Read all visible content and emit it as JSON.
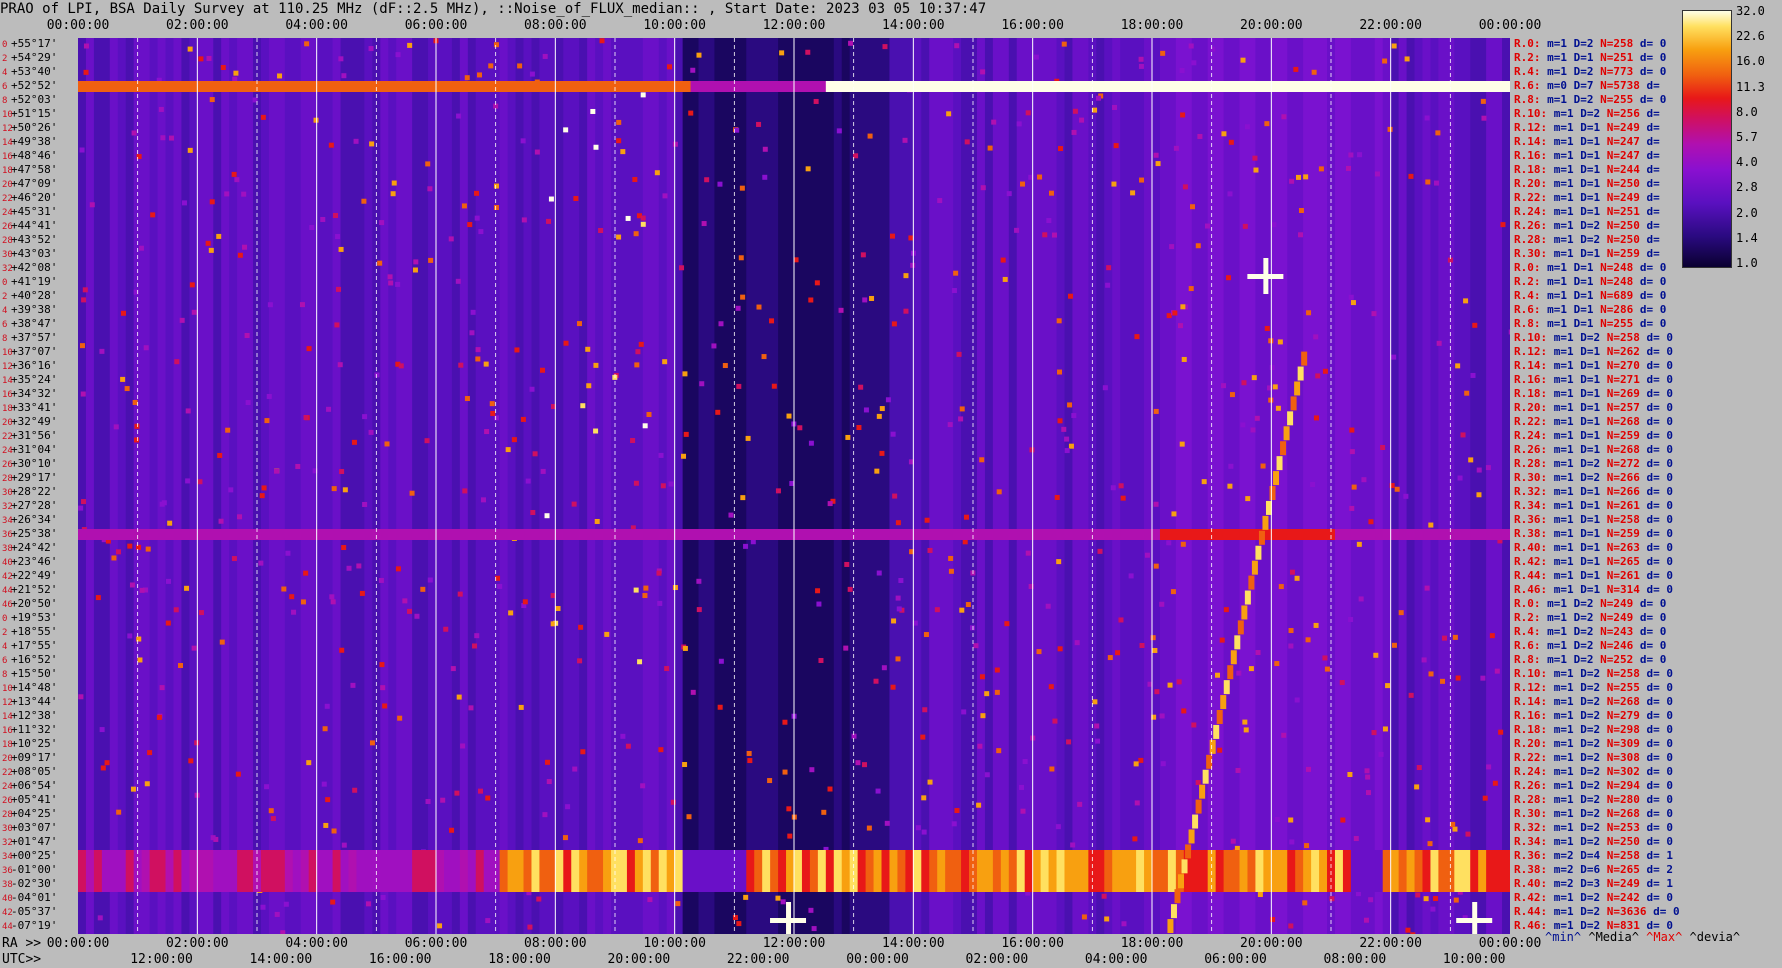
{
  "title": "PRAO of LPI, BSA Daily Survey at 110.25 MHz (dF::2.5 MHz), ::Noise_of_FLUX_median:: , Start Date: 2023 03 05 10:37:47",
  "chart_data": {
    "type": "heatmap",
    "title": "PRAO of LPI, BSA Daily Survey at 110.25 MHz (dF::2.5 MHz), ::Noise_of_FLUX_median:: , Start Date: 2023 03 05 10:37:47",
    "top_time_ticks": [
      "00:00:00",
      "02:00:00",
      "04:00:00",
      "06:00:00",
      "08:00:00",
      "10:00:00",
      "12:00:00",
      "14:00:00",
      "16:00:00",
      "18:00:00",
      "20:00:00",
      "22:00:00",
      "00:00:00"
    ],
    "ra_ticks": [
      "00:00:00",
      "02:00:00",
      "04:00:00",
      "06:00:00",
      "08:00:00",
      "10:00:00",
      "12:00:00",
      "14:00:00",
      "16:00:00",
      "18:00:00",
      "20:00:00",
      "22:00:00",
      "00:00:00"
    ],
    "utc_ticks": [
      "12:00:00",
      "14:00:00",
      "16:00:00",
      "18:00:00",
      "20:00:00",
      "22:00:00",
      "00:00:00",
      "02:00:00",
      "04:00:00",
      "06:00:00",
      "08:00:00",
      "10:00:00"
    ],
    "ra_prefix": "RA >>",
    "utc_prefix": "UTC>>",
    "colorbar_ticks": [
      "32.0",
      "22.6",
      "16.0",
      "11.3",
      "8.0",
      "5.7",
      "4.0",
      "2.8",
      "2.0",
      "1.4",
      "1.0"
    ],
    "legend": [
      "^min^",
      "^Media^",
      "^Max^",
      "^devia^"
    ],
    "declinations": [
      {
        "i": "0",
        "d": "+55°17'"
      },
      {
        "i": "2",
        "d": "+54°29'"
      },
      {
        "i": "4",
        "d": "+53°40'"
      },
      {
        "i": "6",
        "d": "+52°52'"
      },
      {
        "i": "8",
        "d": "+52°03'"
      },
      {
        "i": "10",
        "d": "+51°15'"
      },
      {
        "i": "12",
        "d": "+50°26'"
      },
      {
        "i": "14",
        "d": "+49°38'"
      },
      {
        "i": "16",
        "d": "+48°46'"
      },
      {
        "i": "18",
        "d": "+47°58'"
      },
      {
        "i": "20",
        "d": "+47°09'"
      },
      {
        "i": "22",
        "d": "+46°20'"
      },
      {
        "i": "24",
        "d": "+45°31'"
      },
      {
        "i": "26",
        "d": "+44°41'"
      },
      {
        "i": "28",
        "d": "+43°52'"
      },
      {
        "i": "30",
        "d": "+43°03'"
      },
      {
        "i": "32",
        "d": "+42°08'"
      },
      {
        "i": "0",
        "d": "+41°19'"
      },
      {
        "i": "2",
        "d": "+40°28'"
      },
      {
        "i": "4",
        "d": "+39°38'"
      },
      {
        "i": "6",
        "d": "+38°47'"
      },
      {
        "i": "8",
        "d": "+37°57'"
      },
      {
        "i": "10",
        "d": "+37°07'"
      },
      {
        "i": "12",
        "d": "+36°16'"
      },
      {
        "i": "14",
        "d": "+35°24'"
      },
      {
        "i": "16",
        "d": "+34°32'"
      },
      {
        "i": "18",
        "d": "+33°41'"
      },
      {
        "i": "20",
        "d": "+32°49'"
      },
      {
        "i": "22",
        "d": "+31°56'"
      },
      {
        "i": "24",
        "d": "+31°04'"
      },
      {
        "i": "26",
        "d": "+30°10'"
      },
      {
        "i": "28",
        "d": "+29°17'"
      },
      {
        "i": "30",
        "d": "+28°22'"
      },
      {
        "i": "32",
        "d": "+27°28'"
      },
      {
        "i": "34",
        "d": "+26°34'"
      },
      {
        "i": "36",
        "d": "+25°38'"
      },
      {
        "i": "38",
        "d": "+24°42'"
      },
      {
        "i": "40",
        "d": "+23°46'"
      },
      {
        "i": "42",
        "d": "+22°49'"
      },
      {
        "i": "44",
        "d": "+21°52'"
      },
      {
        "i": "46",
        "d": "+20°50'"
      },
      {
        "i": "0",
        "d": "+19°53'"
      },
      {
        "i": "2",
        "d": "+18°55'"
      },
      {
        "i": "4",
        "d": "+17°55'"
      },
      {
        "i": "6",
        "d": "+16°52'"
      },
      {
        "i": "8",
        "d": "+15°50'"
      },
      {
        "i": "10",
        "d": "+14°48'"
      },
      {
        "i": "12",
        "d": "+13°44'"
      },
      {
        "i": "14",
        "d": "+12°38'"
      },
      {
        "i": "16",
        "d": "+11°32'"
      },
      {
        "i": "18",
        "d": "+10°25'"
      },
      {
        "i": "20",
        "d": "+09°17'"
      },
      {
        "i": "22",
        "d": "+08°05'"
      },
      {
        "i": "24",
        "d": "+06°54'"
      },
      {
        "i": "26",
        "d": "+05°41'"
      },
      {
        "i": "28",
        "d": "+04°25'"
      },
      {
        "i": "30",
        "d": "+03°07'"
      },
      {
        "i": "32",
        "d": "+01°47'"
      },
      {
        "i": "34",
        "d": "+00°25'"
      },
      {
        "i": "36",
        "d": "-01°00'"
      },
      {
        "i": "38",
        "d": "-02°30'"
      },
      {
        "i": "40",
        "d": "-04°01'"
      },
      {
        "i": "42",
        "d": "-05°37'"
      },
      {
        "i": "44",
        "d": "-07°19'"
      }
    ],
    "row_stats": [
      {
        "r": "R.0:",
        "m": "m=1",
        "d": "D=2",
        "n": "N=258",
        "v": "d= 0"
      },
      {
        "r": "R.2:",
        "m": "m=1",
        "d": "D=1",
        "n": "N=251",
        "v": "d= 0"
      },
      {
        "r": "R.4:",
        "m": "m=1",
        "d": "D=2",
        "n": "N=773",
        "v": "d= 0"
      },
      {
        "r": "R.6:",
        "m": "m=0",
        "d": "D=7",
        "n": "N=5738",
        "v": "d="
      },
      {
        "r": "R.8:",
        "m": "m=1",
        "d": "D=2",
        "n": "N=255",
        "v": "d= 0"
      },
      {
        "r": "R.10:",
        "m": "m=1",
        "d": "D=2",
        "n": "N=256",
        "v": "d="
      },
      {
        "r": "R.12:",
        "m": "m=1",
        "d": "D=1",
        "n": "N=249",
        "v": "d="
      },
      {
        "r": "R.14:",
        "m": "m=1",
        "d": "D=1",
        "n": "N=247",
        "v": "d="
      },
      {
        "r": "R.16:",
        "m": "m=1",
        "d": "D=1",
        "n": "N=247",
        "v": "d="
      },
      {
        "r": "R.18:",
        "m": "m=1",
        "d": "D=1",
        "n": "N=244",
        "v": "d="
      },
      {
        "r": "R.20:",
        "m": "m=1",
        "d": "D=1",
        "n": "N=250",
        "v": "d="
      },
      {
        "r": "R.22:",
        "m": "m=1",
        "d": "D=1",
        "n": "N=249",
        "v": "d="
      },
      {
        "r": "R.24:",
        "m": "m=1",
        "d": "D=1",
        "n": "N=251",
        "v": "d="
      },
      {
        "r": "R.26:",
        "m": "m=1",
        "d": "D=2",
        "n": "N=250",
        "v": "d="
      },
      {
        "r": "R.28:",
        "m": "m=1",
        "d": "D=2",
        "n": "N=250",
        "v": "d="
      },
      {
        "r": "R.30:",
        "m": "m=1",
        "d": "D=1",
        "n": "N=259",
        "v": "d="
      },
      {
        "r": "R.0:",
        "m": "m=1",
        "d": "D=1",
        "n": "N=248",
        "v": "d= 0"
      },
      {
        "r": "R.2:",
        "m": "m=1",
        "d": "D=1",
        "n": "N=248",
        "v": "d= 0"
      },
      {
        "r": "R.4:",
        "m": "m=1",
        "d": "D=1",
        "n": "N=689",
        "v": "d= 0"
      },
      {
        "r": "R.6:",
        "m": "m=1",
        "d": "D=1",
        "n": "N=286",
        "v": "d= 0"
      },
      {
        "r": "R.8:",
        "m": "m=1",
        "d": "D=1",
        "n": "N=255",
        "v": "d= 0"
      },
      {
        "r": "R.10:",
        "m": "m=1",
        "d": "D=2",
        "n": "N=258",
        "v": "d= 0"
      },
      {
        "r": "R.12:",
        "m": "m=1",
        "d": "D=1",
        "n": "N=262",
        "v": "d= 0"
      },
      {
        "r": "R.14:",
        "m": "m=1",
        "d": "D=1",
        "n": "N=270",
        "v": "d= 0"
      },
      {
        "r": "R.16:",
        "m": "m=1",
        "d": "D=1",
        "n": "N=271",
        "v": "d= 0"
      },
      {
        "r": "R.18:",
        "m": "m=1",
        "d": "D=1",
        "n": "N=269",
        "v": "d= 0"
      },
      {
        "r": "R.20:",
        "m": "m=1",
        "d": "D=1",
        "n": "N=257",
        "v": "d= 0"
      },
      {
        "r": "R.22:",
        "m": "m=1",
        "d": "D=1",
        "n": "N=268",
        "v": "d= 0"
      },
      {
        "r": "R.24:",
        "m": "m=1",
        "d": "D=1",
        "n": "N=259",
        "v": "d= 0"
      },
      {
        "r": "R.26:",
        "m": "m=1",
        "d": "D=1",
        "n": "N=268",
        "v": "d= 0"
      },
      {
        "r": "R.28:",
        "m": "m=1",
        "d": "D=2",
        "n": "N=272",
        "v": "d= 0"
      },
      {
        "r": "R.30:",
        "m": "m=1",
        "d": "D=2",
        "n": "N=266",
        "v": "d= 0"
      },
      {
        "r": "R.32:",
        "m": "m=1",
        "d": "D=1",
        "n": "N=266",
        "v": "d= 0"
      },
      {
        "r": "R.34:",
        "m": "m=1",
        "d": "D=1",
        "n": "N=261",
        "v": "d= 0"
      },
      {
        "r": "R.36:",
        "m": "m=1",
        "d": "D=1",
        "n": "N=258",
        "v": "d= 0"
      },
      {
        "r": "R.38:",
        "m": "m=1",
        "d": "D=1",
        "n": "N=259",
        "v": "d= 0"
      },
      {
        "r": "R.40:",
        "m": "m=1",
        "d": "D=1",
        "n": "N=263",
        "v": "d= 0"
      },
      {
        "r": "R.42:",
        "m": "m=1",
        "d": "D=1",
        "n": "N=265",
        "v": "d= 0"
      },
      {
        "r": "R.44:",
        "m": "m=1",
        "d": "D=1",
        "n": "N=261",
        "v": "d= 0"
      },
      {
        "r": "R.46:",
        "m": "m=1",
        "d": "D=1",
        "n": "N=314",
        "v": "d= 0"
      },
      {
        "r": "R.0:",
        "m": "m=1",
        "d": "D=2",
        "n": "N=249",
        "v": "d= 0"
      },
      {
        "r": "R.2:",
        "m": "m=1",
        "d": "D=2",
        "n": "N=249",
        "v": "d= 0"
      },
      {
        "r": "R.4:",
        "m": "m=1",
        "d": "D=2",
        "n": "N=243",
        "v": "d= 0"
      },
      {
        "r": "R.6:",
        "m": "m=1",
        "d": "D=2",
        "n": "N=246",
        "v": "d= 0"
      },
      {
        "r": "R.8:",
        "m": "m=1",
        "d": "D=2",
        "n": "N=252",
        "v": "d= 0"
      },
      {
        "r": "R.10:",
        "m": "m=1",
        "d": "D=2",
        "n": "N=258",
        "v": "d= 0"
      },
      {
        "r": "R.12:",
        "m": "m=1",
        "d": "D=2",
        "n": "N=255",
        "v": "d= 0"
      },
      {
        "r": "R.14:",
        "m": "m=1",
        "d": "D=2",
        "n": "N=268",
        "v": "d= 0"
      },
      {
        "r": "R.16:",
        "m": "m=1",
        "d": "D=2",
        "n": "N=279",
        "v": "d= 0"
      },
      {
        "r": "R.18:",
        "m": "m=1",
        "d": "D=2",
        "n": "N=298",
        "v": "d= 0"
      },
      {
        "r": "R.20:",
        "m": "m=1",
        "d": "D=2",
        "n": "N=309",
        "v": "d= 0"
      },
      {
        "r": "R.22:",
        "m": "m=1",
        "d": "D=2",
        "n": "N=308",
        "v": "d= 0"
      },
      {
        "r": "R.24:",
        "m": "m=1",
        "d": "D=2",
        "n": "N=302",
        "v": "d= 0"
      },
      {
        "r": "R.26:",
        "m": "m=1",
        "d": "D=2",
        "n": "N=294",
        "v": "d= 0"
      },
      {
        "r": "R.28:",
        "m": "m=1",
        "d": "D=2",
        "n": "N=280",
        "v": "d= 0"
      },
      {
        "r": "R.30:",
        "m": "m=1",
        "d": "D=2",
        "n": "N=268",
        "v": "d= 0"
      },
      {
        "r": "R.32:",
        "m": "m=1",
        "d": "D=2",
        "n": "N=253",
        "v": "d= 0"
      },
      {
        "r": "R.34:",
        "m": "m=1",
        "d": "D=2",
        "n": "N=250",
        "v": "d= 0"
      },
      {
        "r": "R.36:",
        "m": "m=2",
        "d": "D=4",
        "n": "N=258",
        "v": "d= 1"
      },
      {
        "r": "R.38:",
        "m": "m=2",
        "d": "D=6",
        "n": "N=265",
        "v": "d= 2"
      },
      {
        "r": "R.40:",
        "m": "m=2",
        "d": "D=3",
        "n": "N=249",
        "v": "d= 1"
      },
      {
        "r": "R.42:",
        "m": "m=1",
        "d": "D=2",
        "n": "N=242",
        "v": "d= 0"
      },
      {
        "r": "R.44:",
        "m": "m=1",
        "d": "D=2",
        "n": "N=3636",
        "v": "d= 0"
      },
      {
        "r": "R.46:",
        "m": "m=1",
        "d": "D=2",
        "n": "N=831",
        "v": "d= 0"
      }
    ],
    "bright_rows": [
      3,
      35
    ],
    "bright_bands": [
      {
        "row_from": 58,
        "row_to": 61
      }
    ],
    "sources": [
      {
        "row": 17,
        "hour": 19.9
      },
      {
        "row": 63,
        "hour": 23.4
      },
      {
        "row": 63,
        "hour": 11.9
      }
    ],
    "solar_track": {
      "start_hour": 18.2,
      "end_hour": 20.5
    },
    "band_gaps_hours": [
      [
        10.1,
        11.2
      ],
      [
        21.3,
        21.8
      ]
    ],
    "colors": {
      "background": "#bcbcbc",
      "plot_bg": "#100a40",
      "label_red": "#d01020",
      "label_blue": "#001090"
    }
  }
}
